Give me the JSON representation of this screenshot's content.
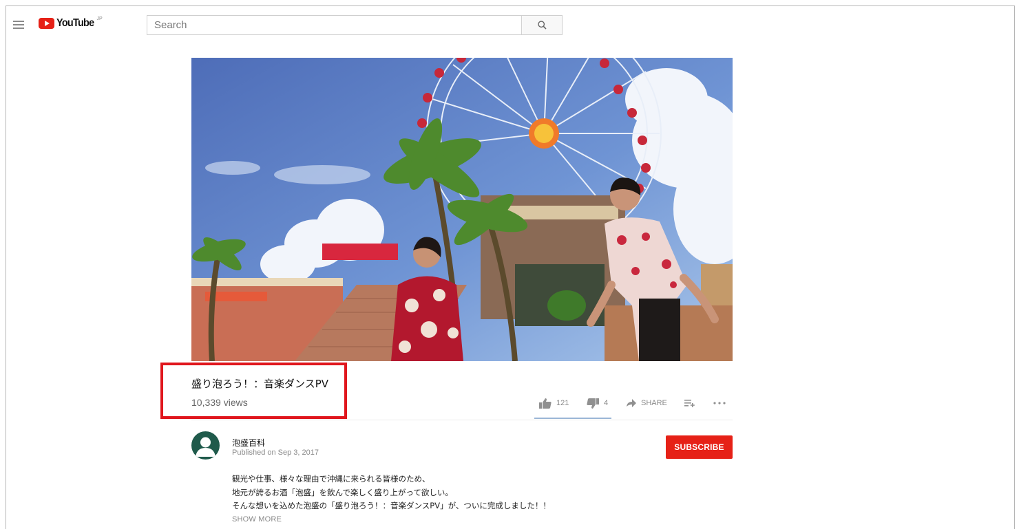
{
  "masthead": {
    "logo_text": "YouTube",
    "logo_region": "JP",
    "search_placeholder": "Search"
  },
  "video": {
    "title": "盛り泡ろう！：音楽ダンスPV",
    "views": "10,339 views",
    "likes": "121",
    "dislikes": "4",
    "share_label": "SHARE"
  },
  "channel": {
    "name": "泡盛百科",
    "published": "Published on Sep 3, 2017",
    "subscribe_label": "SUBSCRIBE"
  },
  "description": {
    "lines": [
      "観光や仕事、様々な理由で沖縄に来られる皆様のため、",
      "地元が誇るお酒「泡盛」を飲んで楽しく盛り上がって欲しい。",
      "そんな想いを込めた泡盛の「盛り泡ろう！：音楽ダンスPV」が、ついに完成しました！！"
    ],
    "show_more_label": "SHOW MORE"
  },
  "colors": {
    "brand_red": "#e62117",
    "highlight_red": "#e0161d"
  }
}
